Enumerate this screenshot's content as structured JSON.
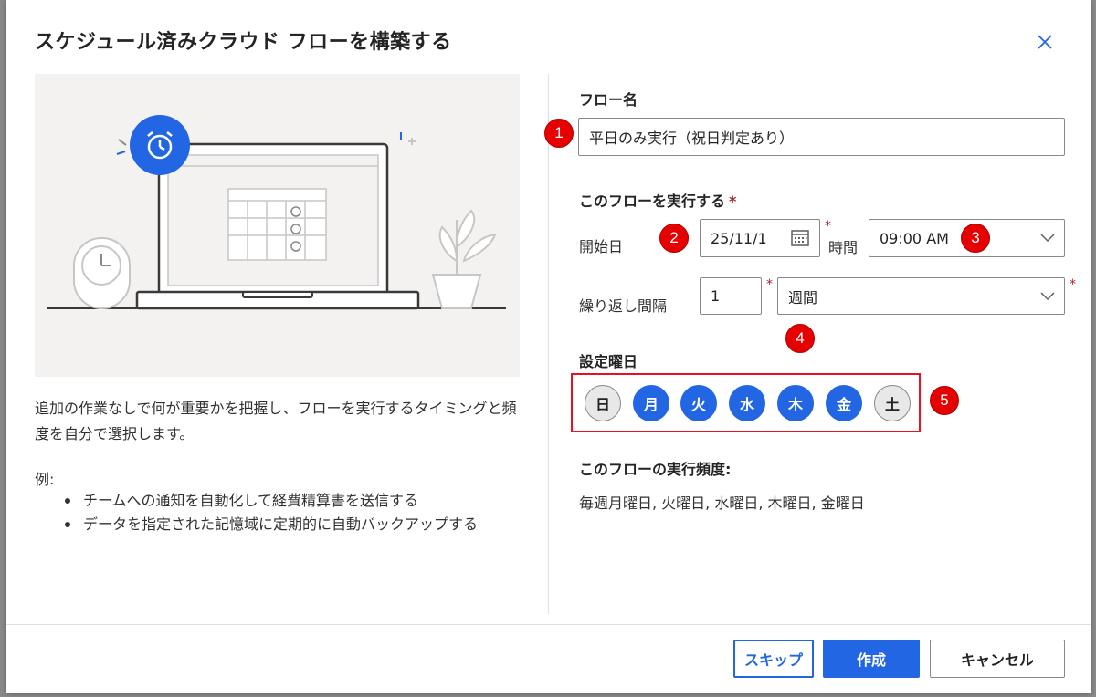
{
  "dialog": {
    "title": "スケジュール済みクラウド フローを構築する",
    "description": "追加の作業なしで何が重要かを把握し、フローを実行するタイミングと頻度を自分で選択します。",
    "example_label": "例:",
    "examples": [
      "チームへの通知を自動化して経費精算書を送信する",
      "データを指定された記憶域に定期的に自動バックアップする"
    ]
  },
  "form": {
    "flow_name_label": "フロー名",
    "flow_name_value": "平日のみ実行（祝日判定あり）",
    "run_label": "このフローを実行する",
    "required_mark": "*",
    "start_date_label": "開始日",
    "start_date_value": "25/11/1",
    "time_label": "時間",
    "time_value": "09:00 AM",
    "repeat_label": "繰り返し間隔",
    "repeat_value": "1",
    "repeat_unit": "週間",
    "days_label": "設定曜日",
    "days": [
      {
        "label": "日",
        "selected": false
      },
      {
        "label": "月",
        "selected": true
      },
      {
        "label": "火",
        "selected": true
      },
      {
        "label": "水",
        "selected": true
      },
      {
        "label": "木",
        "selected": true
      },
      {
        "label": "金",
        "selected": true
      },
      {
        "label": "土",
        "selected": false
      }
    ],
    "frequency_label": "このフローの実行頻度:",
    "frequency_value": "毎週月曜日, 火曜日, 水曜日, 木曜日, 金曜日"
  },
  "annotations": [
    "1",
    "2",
    "3",
    "4",
    "5"
  ],
  "buttons": {
    "skip": "スキップ",
    "create": "作成",
    "cancel": "キャンセル"
  },
  "icons": {
    "close": "close-icon",
    "calendar": "calendar-icon",
    "chevron": "chevron-down-icon",
    "alarm": "alarm-clock-icon"
  },
  "colors": {
    "accent": "#2266e3",
    "annotation": "#e60000",
    "required": "#a4262c"
  }
}
